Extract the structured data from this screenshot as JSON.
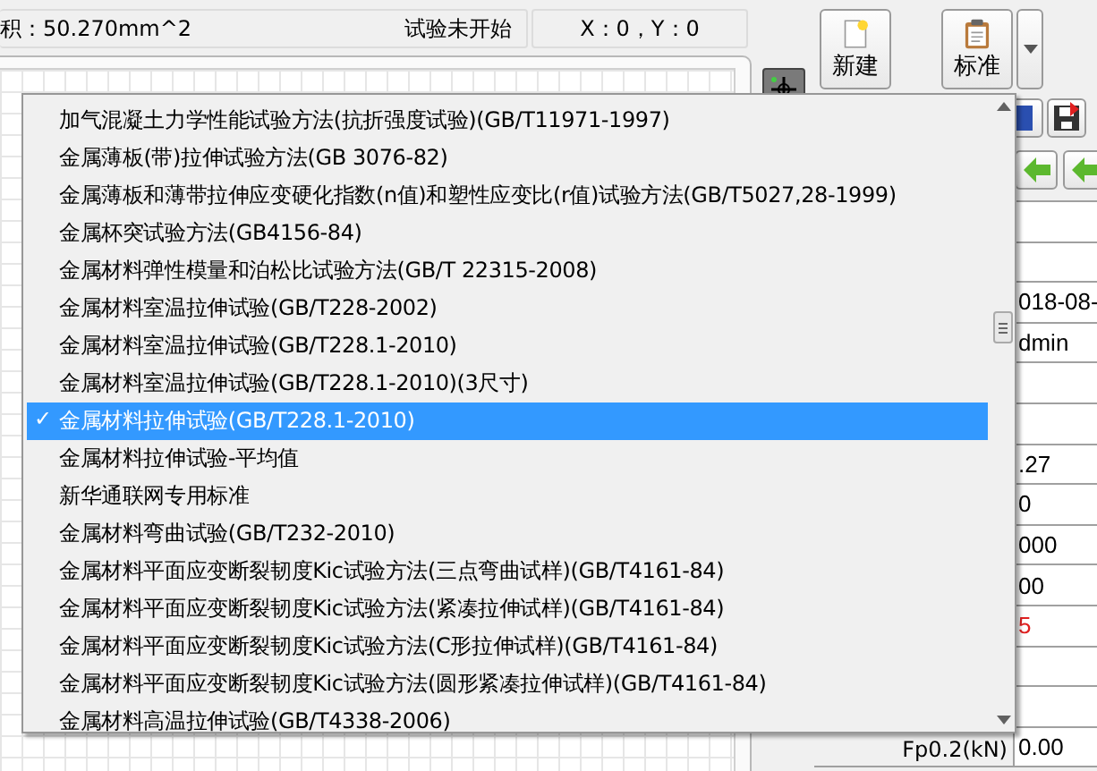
{
  "status_bar": {
    "area": "积：50.270mm^2",
    "test_state": "试验未开始",
    "coords": "X：0，Y：0"
  },
  "toolbar": {
    "buttons": [
      {
        "label": "新建",
        "kind": "new"
      },
      {
        "label": "标准",
        "kind": "standard"
      }
    ]
  },
  "standard_menu": {
    "check_mark": "✓",
    "items": [
      {
        "label": "加气混凝土力学性能试验方法(抗折强度试验)(GB/T11971-1997)",
        "selected": false
      },
      {
        "label": "金属薄板(带)拉伸试验方法(GB 3076-82)",
        "selected": false
      },
      {
        "label": "金属薄板和薄带拉伸应变硬化指数(n值)和塑性应变比(r值)试验方法(GB/T5027,28-1999)",
        "selected": false
      },
      {
        "label": "金属杯突试验方法(GB4156-84)",
        "selected": false
      },
      {
        "label": "金属材料弹性模量和泊松比试验方法(GB/T 22315-2008)",
        "selected": false
      },
      {
        "label": "金属材料室温拉伸试验(GB/T228-2002)",
        "selected": false
      },
      {
        "label": "金属材料室温拉伸试验(GB/T228.1-2010)",
        "selected": false
      },
      {
        "label": "金属材料室温拉伸试验(GB/T228.1-2010)(3尺寸)",
        "selected": false
      },
      {
        "label": "金属材料拉伸试验(GB/T228.1-2010)",
        "selected": true
      },
      {
        "label": "金属材料拉伸试验-平均值",
        "selected": false
      },
      {
        "label": "新华通联网专用标准",
        "selected": false
      },
      {
        "label": "金属材料弯曲试验(GB/T232-2010)",
        "selected": false
      },
      {
        "label": "金属材料平面应变断裂韧度Kic试验方法(三点弯曲试样)(GB/T4161-84)",
        "selected": false
      },
      {
        "label": "金属材料平面应变断裂韧度Kic试验方法(紧凑拉伸试样)(GB/T4161-84)",
        "selected": false
      },
      {
        "label": "金属材料平面应变断裂韧度Kic试验方法(C形拉伸试样)(GB/T4161-84)",
        "selected": false
      },
      {
        "label": "金属材料平面应变断裂韧度Kic试验方法(圆形紧凑拉伸试样)(GB/T4161-84)",
        "selected": false
      },
      {
        "label": "金属材料高温拉伸试验(GB/T4338-2006)",
        "selected": false
      }
    ]
  },
  "side_table": {
    "rows": [
      {},
      {},
      {
        "value": "018-08-",
        "color": "#000000"
      },
      {
        "value": "dmin",
        "color": "#000000"
      },
      {},
      {},
      {
        "value": ".27",
        "color": "#000000"
      },
      {
        "value": "0",
        "color": "#000000"
      },
      {
        "value": "000",
        "color": "#000000"
      },
      {
        "value": "00",
        "color": "#000000"
      },
      {
        "value": "5",
        "color": "#e02020"
      },
      {},
      {},
      {
        "label": "Fp0.2(kN)",
        "value": "0.00",
        "color": "#000000"
      }
    ]
  }
}
